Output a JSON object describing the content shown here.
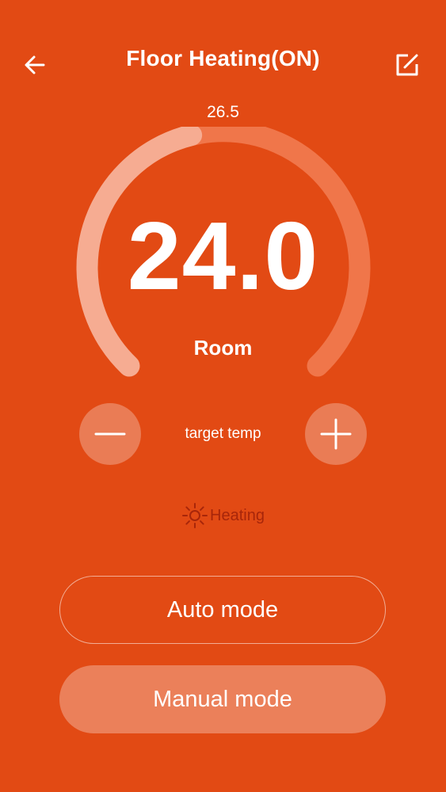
{
  "header": {
    "title": "Floor Heating(ON)",
    "back_icon": "arrow-left-icon",
    "edit_icon": "edit-icon"
  },
  "dial": {
    "setpoint": "26.5",
    "current_temp": "24.0",
    "label": "Room",
    "track_fill_fraction": 0.45
  },
  "controls": {
    "target_label": "target temp",
    "minus_icon": "minus-icon",
    "plus_icon": "plus-icon"
  },
  "status": {
    "icon": "sun-icon",
    "text": "Heating",
    "color": "#A8260A"
  },
  "modes": {
    "auto_label": "Auto mode",
    "manual_label": "Manual mode"
  },
  "colors": {
    "background": "#E24A14",
    "accent": "#FFFFFF"
  }
}
